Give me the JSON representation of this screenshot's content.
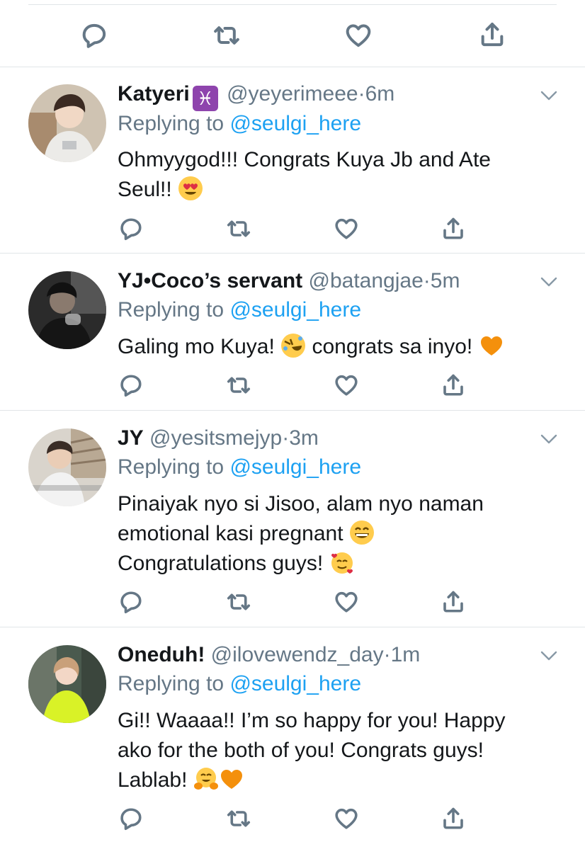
{
  "icons": {
    "reply": "reply-icon",
    "retweet": "retweet-icon",
    "like": "heart-icon",
    "share": "share-icon",
    "more": "chevron-down-icon"
  },
  "colors": {
    "link": "#1da1f2",
    "meta": "#657786",
    "divider": "#e1e5e8"
  },
  "tweets": [
    {
      "name": "Katyeri",
      "name_emoji": "♓",
      "handle": "@yeyerimeee",
      "dot": "·",
      "time": "6m",
      "replying_prefix": "Replying to",
      "replying_to": "@seulgi_here",
      "text_lines": [
        "Ohmyygod!!! Congrats Kuya Jb and Ate",
        "Seul!!"
      ],
      "emojis": [
        "heart-eyes-emoji"
      ]
    },
    {
      "name": "YJ•Coco’s servant",
      "handle": "@batangjae",
      "dot": "·",
      "time": "5m",
      "replying_prefix": "Replying to",
      "replying_to": "@seulgi_here",
      "text_parts": [
        "Galing mo Kuya!",
        "congrats sa inyo!"
      ],
      "emojis": [
        "rolling-laughing-emoji",
        "orange-heart-emoji"
      ]
    },
    {
      "name": "JY",
      "handle": "@yesitsmejyp",
      "dot": "·",
      "time": "3m",
      "replying_prefix": "Replying to",
      "replying_to": "@seulgi_here",
      "text_lines": [
        "Pinaiyak nyo si Jisoo, alam nyo naman",
        "emotional kasi pregnant",
        "Congratulations guys!"
      ],
      "emojis": [
        "grinning-emoji",
        "smiling-hearts-emoji"
      ]
    },
    {
      "name": "Oneduh!",
      "handle": "@ilovewendz_day",
      "dot": "·",
      "time": "1m",
      "replying_prefix": "Replying to",
      "replying_to": "@seulgi_here",
      "text_lines": [
        "Gi!! Waaaa!! I’m so happy for you! Happy",
        "ako for the both of you! Congrats guys!",
        "Lablab!"
      ],
      "emojis": [
        "hugging-emoji",
        "orange-heart-emoji"
      ]
    }
  ]
}
